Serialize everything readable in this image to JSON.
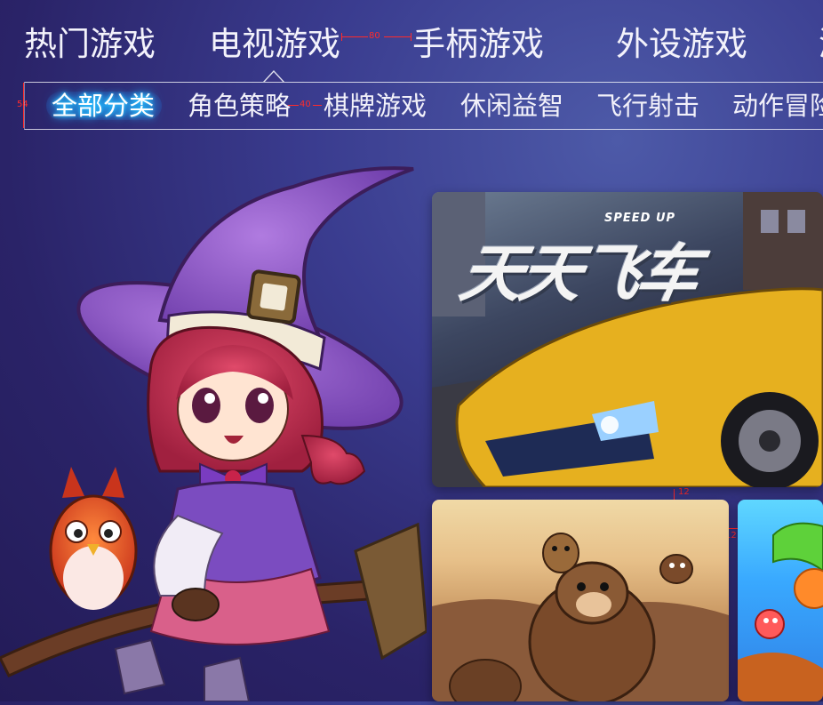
{
  "top_nav": {
    "items": [
      {
        "label": "热门游戏"
      },
      {
        "label": "电视游戏"
      },
      {
        "label": "手柄游戏"
      },
      {
        "label": "外设游戏"
      }
    ],
    "active_index": 1
  },
  "sub_nav": {
    "items": [
      {
        "label": "全部分类"
      },
      {
        "label": "角色策略"
      },
      {
        "label": "棋牌游戏"
      },
      {
        "label": "休闲益智"
      },
      {
        "label": "飞行射击"
      },
      {
        "label": "动作冒险"
      }
    ],
    "active_index": 0,
    "active_glow_color": "#1ba8ff"
  },
  "annotations": {
    "top_gap": "80",
    "subnav_height": "54",
    "subnav_gap": "40",
    "card_gap_vertical": "12",
    "card_gap_horizontal": "12",
    "color": "#ff2b2b"
  },
  "cards": {
    "main": {
      "logo_text": "天天飞车",
      "subtitle": "SPEED UP",
      "icon": "racing-car-image"
    },
    "second": {
      "icon": "bear-cartoon-image"
    },
    "third": {
      "icon": "fruit-cartoon-image"
    }
  },
  "hero": {
    "icon": "witch-girl-illustration"
  },
  "colors": {
    "background": "#2a2368",
    "text": "#f3f2fb",
    "divider": "#ffffff"
  }
}
